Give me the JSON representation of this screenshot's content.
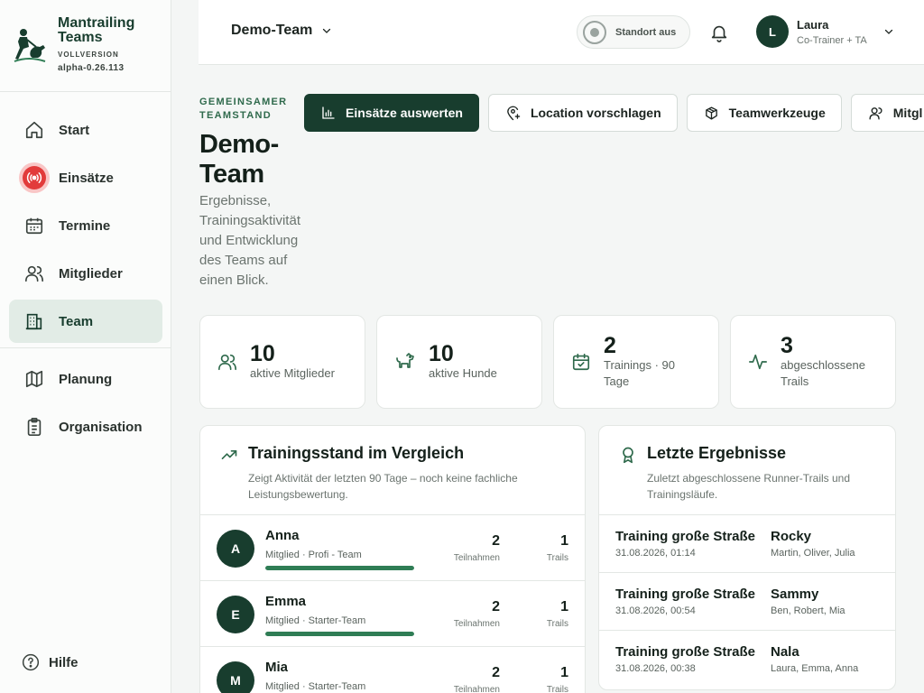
{
  "brand": {
    "name": "Mantrailing Teams",
    "edition": "VOLLVERSION",
    "version": "alpha-0.26.113"
  },
  "nav": {
    "items": [
      {
        "label": "Start",
        "icon": "home-icon"
      },
      {
        "label": "Einsätze",
        "icon": "alarm-icon"
      },
      {
        "label": "Termine",
        "icon": "calendar-icon"
      },
      {
        "label": "Mitglieder",
        "icon": "users-icon"
      },
      {
        "label": "Team",
        "icon": "building-icon",
        "active": true
      },
      {
        "label": "Planung",
        "icon": "map-icon"
      },
      {
        "label": "Organisation",
        "icon": "clipboard-icon"
      }
    ],
    "help_label": "Hilfe"
  },
  "header": {
    "team_name": "Demo-Team",
    "location_label": "Standort aus",
    "user": {
      "initial": "L",
      "name": "Laura",
      "role": "Co-Trainer + TA"
    }
  },
  "page": {
    "eyebrow": "GEMEINSAMER TEAMSTAND",
    "title": "Demo-Team",
    "subtitle": "Ergebnisse, Trainingsaktivität und Entwicklung des Teams auf einen Blick."
  },
  "actions": [
    {
      "label": "Einsätze auswerten",
      "icon": "bar-chart-icon"
    },
    {
      "label": "Location vorschlagen",
      "icon": "map-pin-plus-icon"
    },
    {
      "label": "Teamwerkzeuge",
      "icon": "package-icon"
    },
    {
      "label": "Mitgl",
      "icon": "user-icon"
    }
  ],
  "stats": [
    {
      "value": "10",
      "label": "aktive Mitglieder",
      "icon": "users-icon"
    },
    {
      "value": "10",
      "label": "aktive Hunde",
      "icon": "dog-icon"
    },
    {
      "value": "2",
      "label": "Trainings · 90 Tage",
      "icon": "calendar-check-icon"
    },
    {
      "value": "3",
      "label": "abgeschlossene Trails",
      "icon": "activity-icon"
    }
  ],
  "comparison": {
    "title": "Trainingsstand im Vergleich",
    "subtitle": "Zeigt Aktivität der letzten 90 Tage – noch keine fachliche Leistungsbewertung.",
    "participations_label": "Teilnahmen",
    "trails_label": "Trails",
    "members": [
      {
        "initial": "A",
        "name": "Anna",
        "meta": "Mitglied · Profi - Team",
        "participations": "2",
        "trails": "1",
        "progress": 1.0
      },
      {
        "initial": "E",
        "name": "Emma",
        "meta": "Mitglied · Starter-Team",
        "participations": "2",
        "trails": "1",
        "progress": 1.0
      },
      {
        "initial": "M",
        "name": "Mia",
        "meta": "Mitglied · Starter-Team",
        "participations": "2",
        "trails": "1",
        "progress": 1.0
      }
    ]
  },
  "results": {
    "title": "Letzte Ergebnisse",
    "subtitle": "Zuletzt abgeschlossene Runner-Trails und Trainingsläufe.",
    "items": [
      {
        "title": "Training große Straße",
        "date": "31.08.2026, 01:14",
        "dog": "Rocky",
        "people": "Martin, Oliver, Julia"
      },
      {
        "title": "Training große Straße",
        "date": "31.08.2026, 00:54",
        "dog": "Sammy",
        "people": "Ben, Robert, Mia"
      },
      {
        "title": "Training große Straße",
        "date": "31.08.2026, 00:38",
        "dog": "Nala",
        "people": "Laura, Emma, Anna"
      }
    ]
  },
  "colors": {
    "brand": "#183d2e",
    "accent": "#2f7d55",
    "alarm": "#e23b3b"
  }
}
